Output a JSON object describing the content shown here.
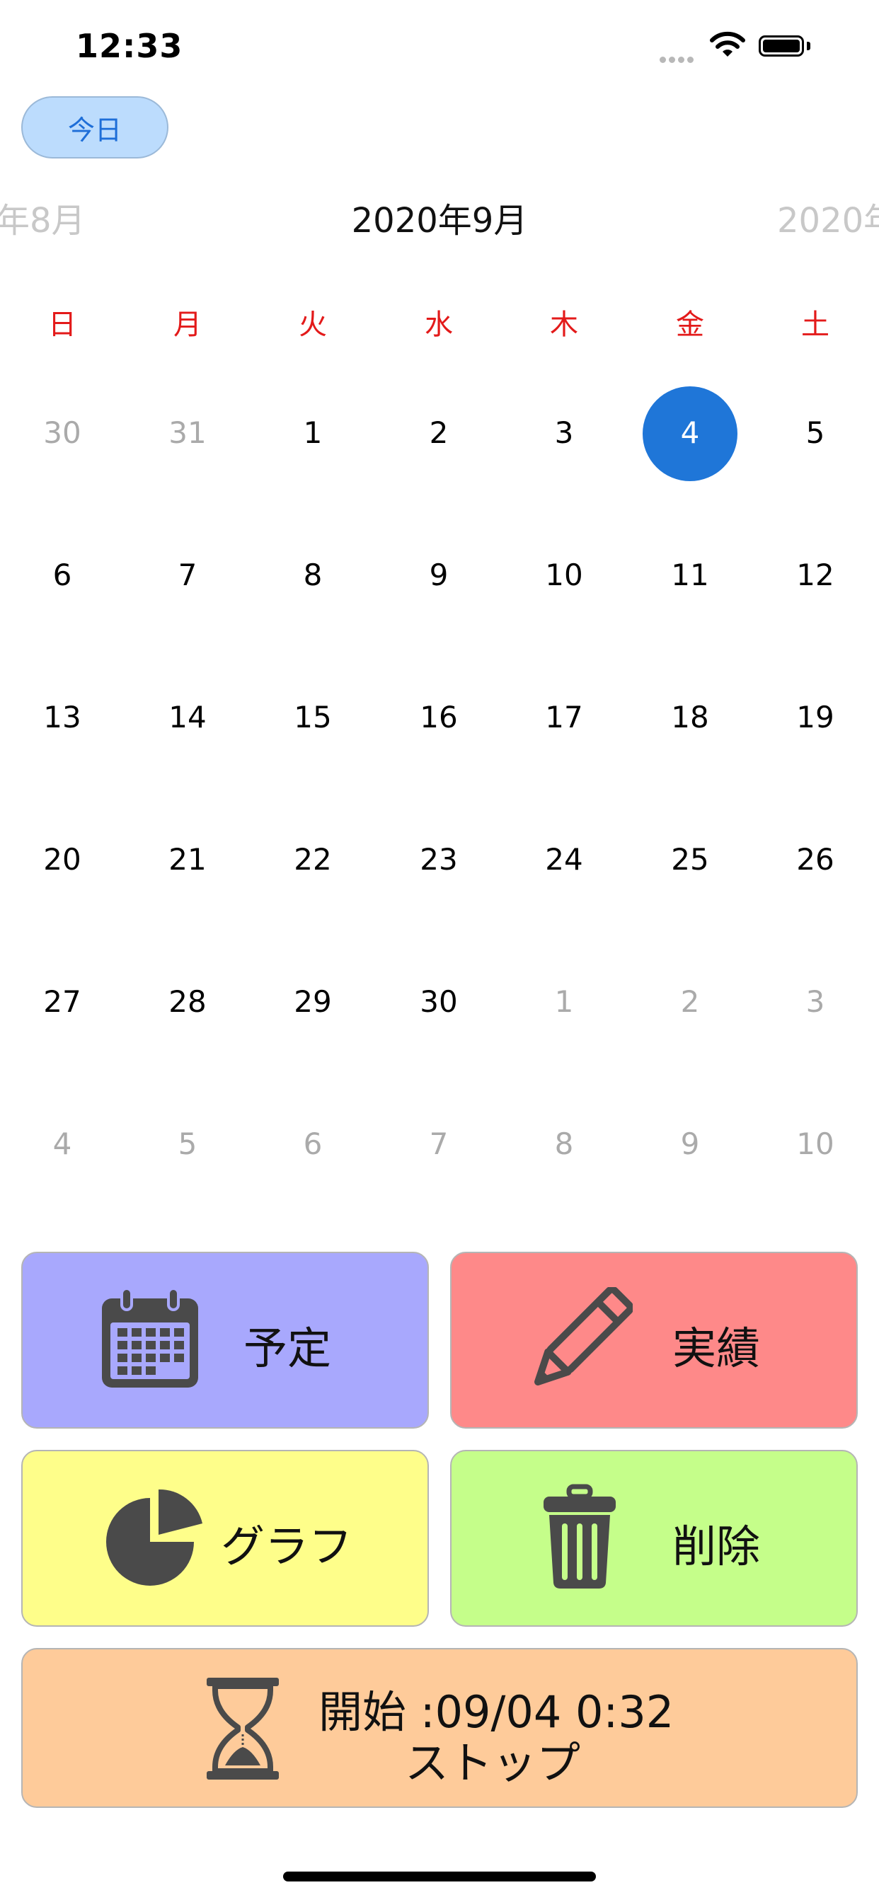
{
  "status_bar": {
    "time": "12:33"
  },
  "today_button": {
    "label": "今日"
  },
  "calendar": {
    "prev_month": "年8月",
    "current_month": "2020年9月",
    "next_month": "2020年",
    "weekdays": [
      "日",
      "月",
      "火",
      "水",
      "木",
      "金",
      "土"
    ],
    "selected_day": "4",
    "weeks": [
      [
        "30",
        "31",
        "1",
        "2",
        "3",
        "4",
        "5"
      ],
      [
        "6",
        "7",
        "8",
        "9",
        "10",
        "11",
        "12"
      ],
      [
        "13",
        "14",
        "15",
        "16",
        "17",
        "18",
        "19"
      ],
      [
        "20",
        "21",
        "22",
        "23",
        "24",
        "25",
        "26"
      ],
      [
        "27",
        "28",
        "29",
        "30",
        "1",
        "2",
        "3"
      ],
      [
        "4",
        "5",
        "6",
        "7",
        "8",
        "9",
        "10"
      ]
    ]
  },
  "actions": {
    "schedule": {
      "label": "予定",
      "icon": "calendar-icon",
      "color": "#a8a8fd"
    },
    "record": {
      "label": "実績",
      "icon": "pencil-icon",
      "color": "#fe8989"
    },
    "graph": {
      "label": "グラフ",
      "icon": "pie-chart-icon",
      "color": "#fefe8a"
    },
    "delete": {
      "label": "削除",
      "icon": "trash-icon",
      "color": "#c5fe8a"
    },
    "timer": {
      "start_label": "開始 :09/04 0:32",
      "stop_label": "ストップ",
      "icon": "hourglass-icon",
      "color": "#fecb9a"
    }
  }
}
